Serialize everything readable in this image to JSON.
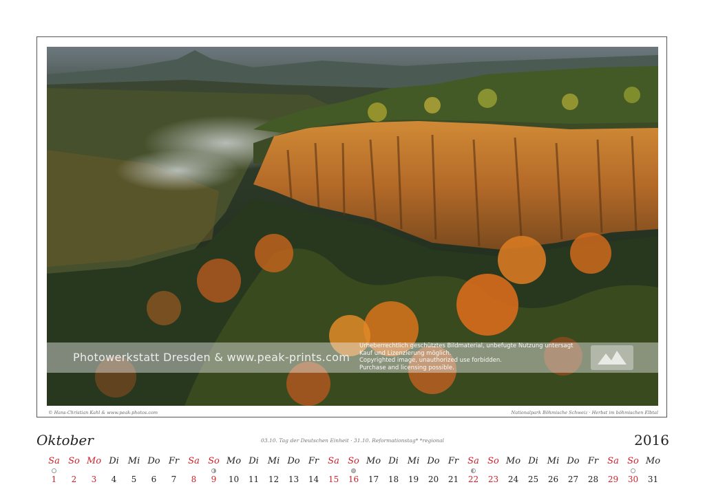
{
  "watermark": {
    "left_text": "Photowerkstatt Dresden & www.peak-prints.com",
    "right_lines": [
      "Urheberrechtlich geschütztes Bildmaterial, unbefugte Nutzung untersagt",
      "Kauf und Lizenzierung möglich.",
      "Copyrighted image, unauthorized use forbidden.",
      "Purchase and licensing possible."
    ]
  },
  "caption": {
    "left": "© Hans-Christian Kahl & www.peak-photos.com",
    "right": "Nationalpark Böhmische Schweiz · Herbst im böhmischen Elbtal"
  },
  "calendar": {
    "month": "Oktober",
    "year": "2016",
    "holidays": "03.10. Tag der Deutschen Einheit  ·  31.10. Reformationstag* *regional",
    "weekday_labels": [
      "Sa",
      "So",
      "Mo",
      "Di",
      "Mi",
      "Do",
      "Fr",
      "Sa",
      "So",
      "Mo",
      "Di",
      "Mi",
      "Do",
      "Fr",
      "Sa",
      "So",
      "Mo",
      "Di",
      "Mi",
      "Do",
      "Fr",
      "Sa",
      "So",
      "Mo",
      "Di",
      "Mi",
      "Do",
      "Fr",
      "Sa",
      "So",
      "Mo"
    ],
    "dates": [
      "1",
      "2",
      "3",
      "4",
      "5",
      "6",
      "7",
      "8",
      "9",
      "10",
      "11",
      "12",
      "13",
      "14",
      "15",
      "16",
      "17",
      "18",
      "19",
      "20",
      "21",
      "22",
      "23",
      "24",
      "25",
      "26",
      "27",
      "28",
      "29",
      "30",
      "31"
    ],
    "red_indices": [
      0,
      1,
      2,
      7,
      8,
      14,
      15,
      21,
      22,
      28,
      29
    ],
    "moon_phases": [
      {
        "index": 0,
        "phase": "new"
      },
      {
        "index": 8,
        "phase": "first"
      },
      {
        "index": 15,
        "phase": "full"
      },
      {
        "index": 21,
        "phase": "last"
      },
      {
        "index": 29,
        "phase": "new"
      }
    ]
  },
  "colors": {
    "weekend_red": "#d0202a",
    "text": "#222222"
  }
}
